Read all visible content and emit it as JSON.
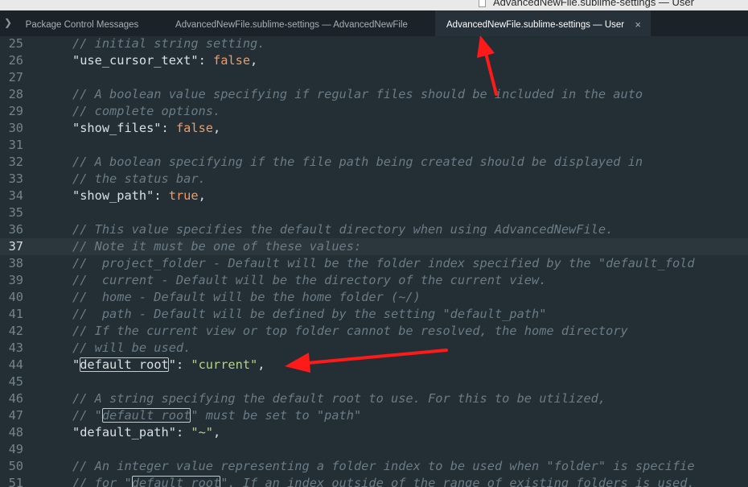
{
  "window": {
    "title": "AdvancedNewFile.sublime-settings — User"
  },
  "tabs": [
    {
      "label": "Package Control Messages"
    },
    {
      "label": "AdvancedNewFile.sublime-settings — AdvancedNewFile"
    },
    {
      "label": "AdvancedNewFile.sublime-settings — User",
      "active": true,
      "close": "×"
    }
  ],
  "colors": {
    "background": "#232e35",
    "comment": "#6c7b84",
    "key": "#d8e0e4",
    "boolean": "#f29b63",
    "string": "#b5d383",
    "annotation_arrow": "#ff1a1a"
  },
  "editor": {
    "lines": [
      {
        "n": "25",
        "text": "// initial string setting."
      },
      {
        "n": "26",
        "key": "\"use_cursor_text\"",
        "val": "false"
      },
      {
        "n": "27",
        "text": ""
      },
      {
        "n": "28",
        "text": "// A boolean value specifying if regular files should be included in the auto"
      },
      {
        "n": "29",
        "text": "// complete options."
      },
      {
        "n": "30",
        "key": "\"show_files\"",
        "val": "false"
      },
      {
        "n": "31",
        "text": ""
      },
      {
        "n": "32",
        "text": "// A boolean specifying if the file path being created should be displayed in"
      },
      {
        "n": "33",
        "text": "// the status bar."
      },
      {
        "n": "34",
        "key": "\"show_path\"",
        "val": "true"
      },
      {
        "n": "35",
        "text": ""
      },
      {
        "n": "36",
        "text": "// This value specifies the default directory when using AdvancedNewFile."
      },
      {
        "n": "37",
        "text": "// Note it must be one of these values:"
      },
      {
        "n": "38",
        "text": "//  project_folder - Default will be the folder index specified by the \"default_fold"
      },
      {
        "n": "39",
        "text": "//  current - Default will be the directory of the current view."
      },
      {
        "n": "40",
        "text": "//  home - Default will be the home folder (~/)"
      },
      {
        "n": "41",
        "text": "//  path - Default will be defined by the setting \"default_path\""
      },
      {
        "n": "42",
        "text": "// If the current view or top folder cannot be resolved, the home directory"
      },
      {
        "n": "43",
        "text": "// will be used."
      },
      {
        "n": "44",
        "key_open": "\"",
        "key_word": "default_root",
        "key_close": "\"",
        "colon": ": ",
        "val": "\"current\"",
        "end": ","
      },
      {
        "n": "45",
        "text": ""
      },
      {
        "n": "46",
        "text": "// A string specifying the default root to use. For this to be utilized,"
      },
      {
        "n": "47",
        "pre": "// \"",
        "word": "default_root",
        "post": "\" must be set to \"path\""
      },
      {
        "n": "48",
        "key": "\"default_path\"",
        "val": "\"~\""
      },
      {
        "n": "49",
        "text": ""
      },
      {
        "n": "50",
        "text": "// An integer value representing a folder index to be used when \"folder\" is specifie"
      },
      {
        "n": "51",
        "pre": "// for \"",
        "word": "default_root",
        "post": "\". If an index outside of the range of existing folders is used,"
      }
    ]
  }
}
